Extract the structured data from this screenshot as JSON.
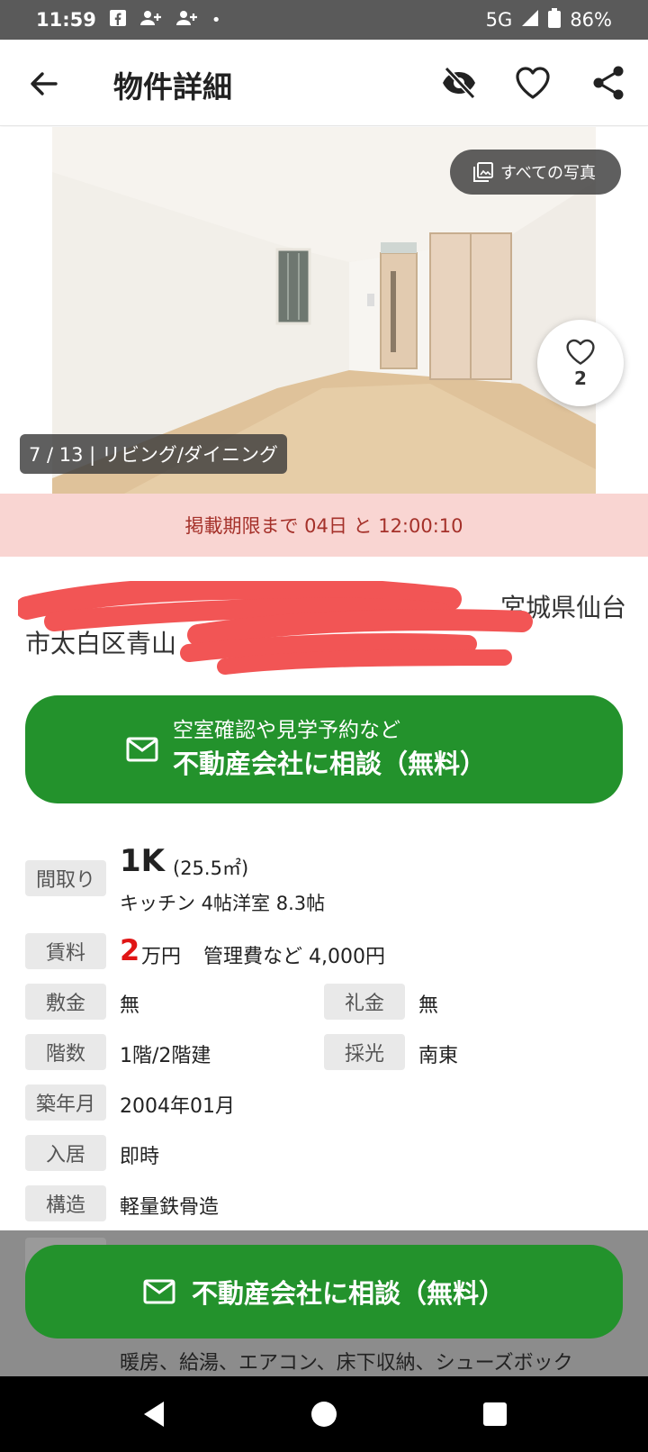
{
  "status_bar": {
    "time": "11:59",
    "network": "5G",
    "battery": "86%",
    "dot": "•"
  },
  "header": {
    "title": "物件詳細",
    "icons": [
      "back-arrow-icon",
      "eye-off-icon",
      "heart-icon",
      "share-icon"
    ]
  },
  "photo": {
    "all_photos_label": "すべての写真",
    "caption": "7 / 13 | リビング/ダイニング",
    "like_count": "2"
  },
  "deadline": {
    "text": "掲載期限まで 04日 と 12:00:10"
  },
  "address": {
    "line1_visible": "宮城県仙台",
    "line2_visible": "市太白区青山"
  },
  "consult_button": {
    "sub": "空室確認や見学予約など",
    "main": "不動産会社に相談（無料）"
  },
  "details": {
    "layout_label": "間取り",
    "layout_value": "1K",
    "layout_area": "(25.5㎡)",
    "layout_detail": "キッチン 4帖洋室 8.3帖",
    "rent_label": "賃料",
    "rent_number": "2",
    "rent_unit": "万円",
    "management_fee": "管理費など 4,000円",
    "deposit_label": "敷金",
    "deposit_value": "無",
    "key_money_label": "礼金",
    "key_money_value": "無",
    "floor_label": "階数",
    "floor_value": "1階/2階建",
    "light_label": "採光",
    "light_value": "南東",
    "built_label": "築年月",
    "built_value": "2004年01月",
    "move_in_label": "入居",
    "move_in_value": "即時",
    "structure_label": "構造",
    "structure_value": "軽量鉄骨造",
    "facilities_line2": "暖房、給湯、エアコン、床下収納、シューズボック"
  },
  "bottom_button": {
    "label": "不動産会社に相談（無料）"
  },
  "colors": {
    "accent_green": "#23922c",
    "deadline_bg": "#f9d5d2",
    "deadline_text": "#a5312a",
    "rent_red": "#e01515"
  }
}
